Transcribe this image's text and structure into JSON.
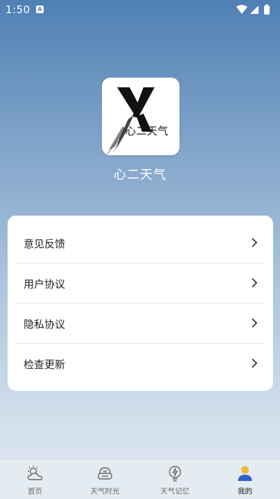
{
  "status_bar": {
    "time": "1:50",
    "notification_glyph": "A"
  },
  "app": {
    "logo_text": "心二天气",
    "name": "心二天气"
  },
  "menu": {
    "items": [
      {
        "label": "意见反馈"
      },
      {
        "label": "用户协议"
      },
      {
        "label": "隐私协议"
      },
      {
        "label": "检查更新"
      }
    ]
  },
  "tabs": [
    {
      "label": "首页",
      "icon": "sun-cloud-icon"
    },
    {
      "label": "天气时光",
      "icon": "weather-time-icon"
    },
    {
      "label": "天气记忆",
      "icon": "lightning-bulb-icon"
    },
    {
      "label": "我的",
      "icon": "user-icon",
      "active": true
    }
  ],
  "colors": {
    "active_tab": "#2f5fc8",
    "background_top": "#4f80b4",
    "background_bottom": "#dfe8f1"
  }
}
